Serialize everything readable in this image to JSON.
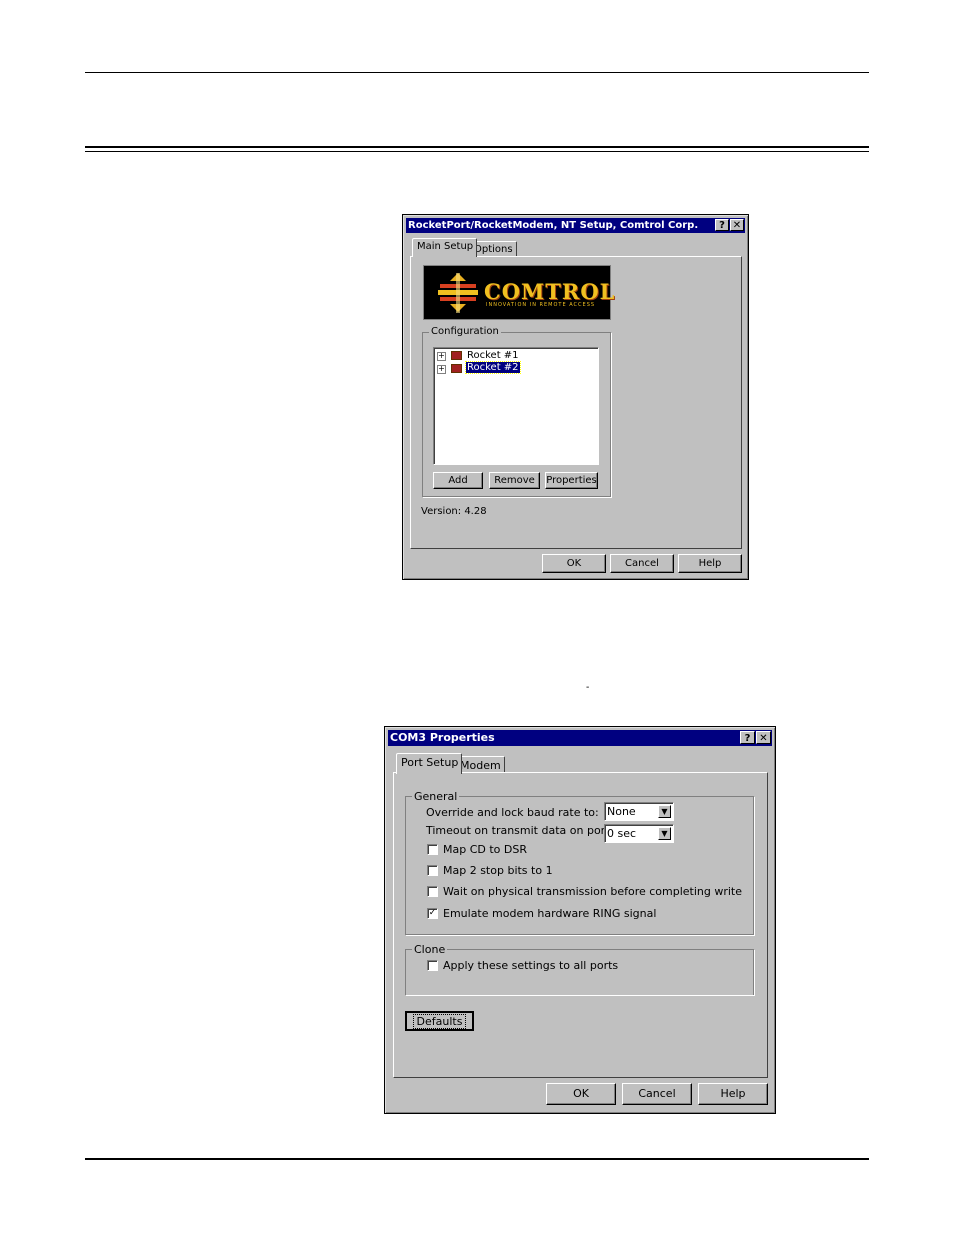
{
  "dialog1": {
    "title": "RocketPort/RocketModem, NT Setup, Comtrol Corp.",
    "help_btn": "?",
    "close_btn": "✕",
    "tabs": [
      {
        "label": "Main Setup",
        "active": true
      },
      {
        "label": "Options",
        "active": false
      }
    ],
    "logo": {
      "wordmark": "COMTROL",
      "tagline": "INNOVATION IN REMOTE ACCESS"
    },
    "configuration": {
      "label": "Configuration",
      "items": [
        {
          "label": "Rocket #1",
          "selected": false,
          "expander": "+"
        },
        {
          "label": "Rocket #2",
          "selected": true,
          "expander": "+"
        }
      ],
      "buttons": {
        "add": "Add",
        "remove": "Remove",
        "properties": "Properties"
      }
    },
    "version": "Version: 4.28",
    "buttons": {
      "ok": "OK",
      "cancel": "Cancel",
      "help": "Help"
    }
  },
  "dialog2": {
    "title": "COM3 Properties",
    "help_btn": "?",
    "close_btn": "✕",
    "tabs": [
      {
        "label": "Port Setup",
        "active": true
      },
      {
        "label": "Modem",
        "active": false
      }
    ],
    "general": {
      "label": "General",
      "baud_label": "Override and lock baud rate to:",
      "baud_value": "None",
      "timeout_label": "Timeout on transmit data on port close:",
      "timeout_value": "0 sec",
      "checkboxes": [
        {
          "label": "Map CD to DSR",
          "checked": false
        },
        {
          "label": "Map 2 stop bits to 1",
          "checked": false
        },
        {
          "label": "Wait on physical transmission before completing write",
          "checked": false
        },
        {
          "label": "Emulate modem hardware RING signal",
          "checked": true
        }
      ]
    },
    "clone": {
      "label": "Clone",
      "checkbox": {
        "label": "Apply these settings to all ports",
        "checked": false
      }
    },
    "defaults_button": "Defaults",
    "buttons": {
      "ok": "OK",
      "cancel": "Cancel",
      "help": "Help"
    }
  },
  "stray_mark": "-",
  "colors": {
    "title_bar": "#000080",
    "dialog_face": "#c0c0c0",
    "logo_bg": "#000000",
    "logo_accent": "#f0c020",
    "selection": "#000080"
  }
}
